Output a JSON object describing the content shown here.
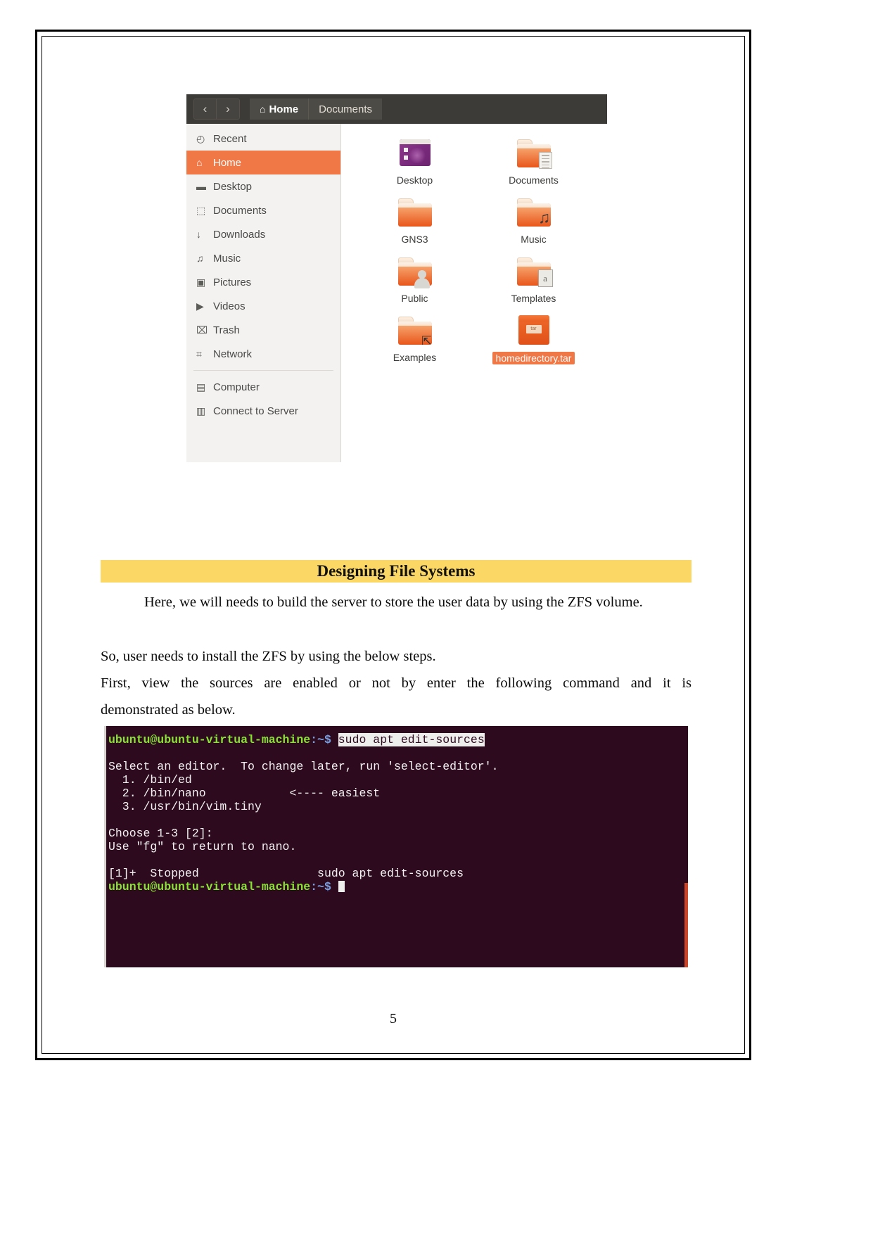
{
  "document": {
    "page_number": "5",
    "heading": "Designing File Systems",
    "paragraphs": {
      "p1": "Here, we will needs to build the server to store the user data by using the ZFS volume.",
      "p2": "So, user needs to install the ZFS by using the below steps.",
      "p3_line1": "First, view the sources are enabled or not by enter the following command and it is",
      "p3_line2": "demonstrated as below."
    },
    "highlight_color": "#fbd765"
  },
  "file_manager": {
    "nav": {
      "back_icon": "‹",
      "forward_icon": "›"
    },
    "breadcrumbs": [
      {
        "label": "Home",
        "icon": "⌂",
        "active": true
      },
      {
        "label": "Documents",
        "icon": "",
        "active": false
      }
    ],
    "sidebar": {
      "items": [
        {
          "label": "Recent",
          "icon": "◴",
          "icon_name": "clock-icon",
          "selected": false
        },
        {
          "label": "Home",
          "icon": "⌂",
          "icon_name": "home-icon",
          "selected": true
        },
        {
          "label": "Desktop",
          "icon": "▬",
          "icon_name": "desktop-folder-icon",
          "selected": false
        },
        {
          "label": "Documents",
          "icon": "⬚",
          "icon_name": "document-icon",
          "selected": false
        },
        {
          "label": "Downloads",
          "icon": "↓",
          "icon_name": "download-icon",
          "selected": false
        },
        {
          "label": "Music",
          "icon": "♫",
          "icon_name": "music-note-icon",
          "selected": false
        },
        {
          "label": "Pictures",
          "icon": "▣",
          "icon_name": "camera-icon",
          "selected": false
        },
        {
          "label": "Videos",
          "icon": "▶",
          "icon_name": "video-icon",
          "selected": false
        },
        {
          "label": "Trash",
          "icon": "⌧",
          "icon_name": "trash-icon",
          "selected": false
        },
        {
          "label": "Network",
          "icon": "⌗",
          "icon_name": "network-icon",
          "selected": false
        }
      ],
      "items_bottom": [
        {
          "label": "Computer",
          "icon": "▤",
          "icon_name": "computer-icon",
          "selected": false
        },
        {
          "label": "Connect to Server",
          "icon": "▥",
          "icon_name": "connect-server-icon",
          "selected": false
        }
      ],
      "selected_color": "#f07746"
    },
    "files": [
      {
        "label": "Desktop",
        "kind": "desktop",
        "selected": false
      },
      {
        "label": "Documents",
        "kind": "docs",
        "selected": false
      },
      {
        "label": "GNS3",
        "kind": "folder",
        "selected": false
      },
      {
        "label": "Music",
        "kind": "music",
        "selected": false
      },
      {
        "label": "Public",
        "kind": "public",
        "selected": false
      },
      {
        "label": "Templates",
        "kind": "template",
        "selected": false
      },
      {
        "label": "Examples",
        "kind": "link",
        "selected": false
      },
      {
        "label": "homedirectory.tar",
        "kind": "tar",
        "selected": true,
        "tar_label": "tar"
      }
    ]
  },
  "terminal": {
    "prompt": "ubuntu@ubuntu-virtual-machine",
    "path": ":~$",
    "command": "sudo apt edit-sources",
    "lines": {
      "l1": "Select an editor.  To change later, run 'select-editor'.",
      "l2": "  1. /bin/ed",
      "l3": "  2. /bin/nano            <---- easiest",
      "l4": "  3. /usr/bin/vim.tiny",
      "l5": "Choose 1-3 [2]:",
      "l6": "Use \"fg\" to return to nano.",
      "l7": "[1]+  Stopped                 sudo apt edit-sources"
    }
  }
}
